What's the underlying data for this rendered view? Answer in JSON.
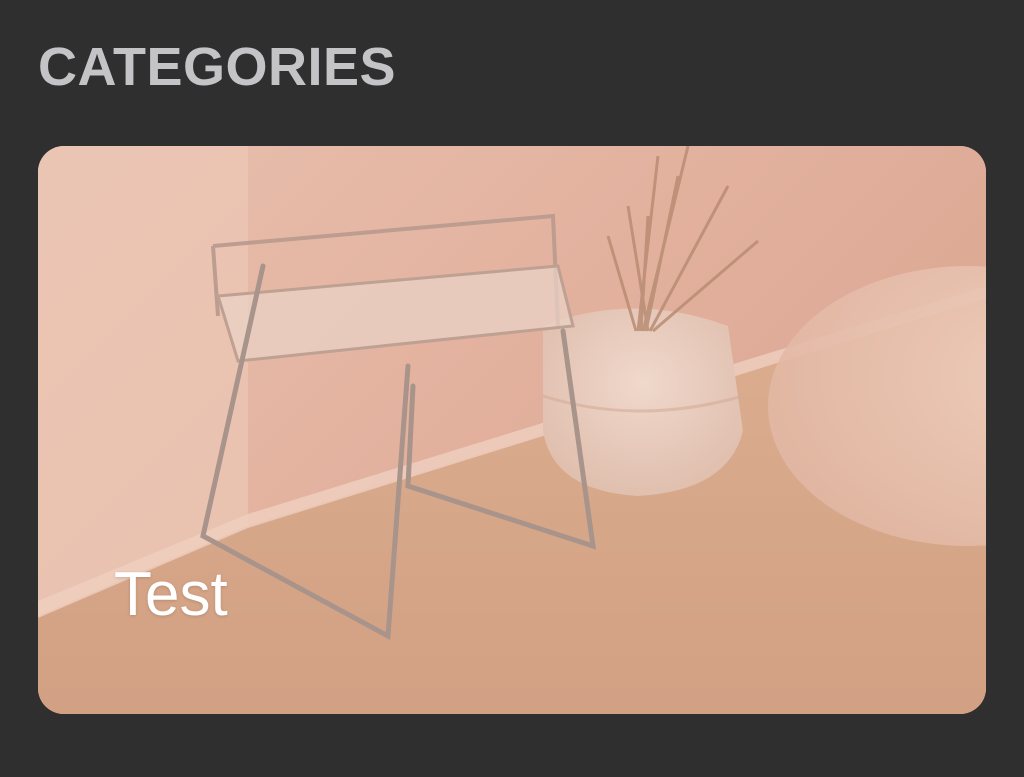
{
  "section": {
    "title": "CATEGORIES"
  },
  "categories": [
    {
      "label": "Test",
      "image": "chair-and-plant-photo",
      "overlay_color": "#d9a993"
    }
  ],
  "colors": {
    "background": "#2f2f30",
    "heading": "#c4c4c6",
    "card_label": "#ffffff"
  }
}
